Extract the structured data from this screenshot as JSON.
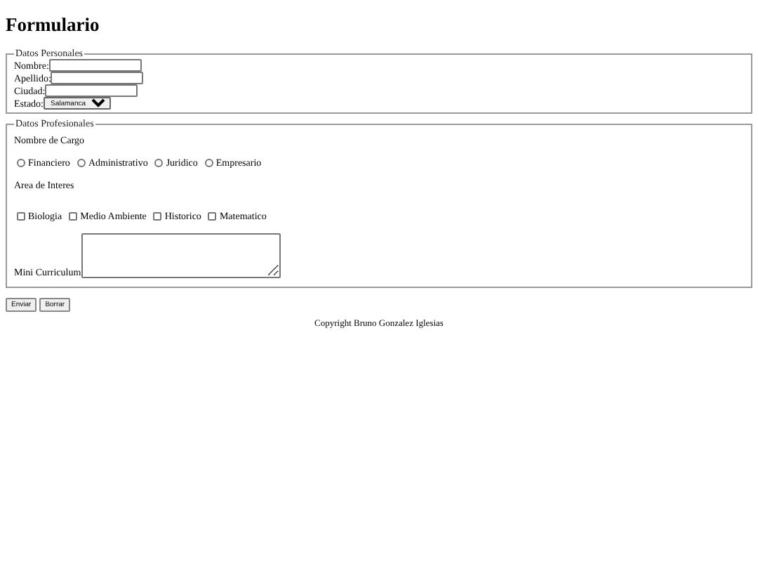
{
  "title": "Formulario",
  "personal": {
    "legend": "Datos Personales",
    "fields": [
      {
        "kind": "text",
        "label": "Nombre:"
      },
      {
        "kind": "text",
        "label": "Apellido:"
      },
      {
        "kind": "text",
        "label": "Ciudad:"
      },
      {
        "kind": "select",
        "label": "Estado:",
        "value": "Salamanca"
      }
    ]
  },
  "professional": {
    "legend": "Datos Profesionales",
    "cargo_label": "Nombre de Cargo",
    "cargos": [
      {
        "label": "Financiero",
        "selected": false
      },
      {
        "label": "Administrativo",
        "selected": false
      },
      {
        "label": "Juridico",
        "selected": false
      },
      {
        "label": "Empresario",
        "selected": false
      }
    ],
    "interes_label": "Area de Interes",
    "intereses": [
      {
        "label": "Biologia",
        "checked": false
      },
      {
        "label": "Medio Ambiente",
        "checked": false
      },
      {
        "label": "Historico",
        "checked": false
      },
      {
        "label": "Matematico",
        "checked": false
      }
    ],
    "curriculum_label": "Mini Curriculum"
  },
  "buttons": [
    "Enviar",
    "Borrar"
  ],
  "footer": "Copyright Bruno Gonzalez Iglesias"
}
